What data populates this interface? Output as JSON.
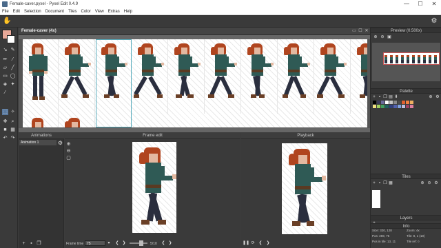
{
  "window": {
    "title": "Female-caver.pyxel - Pyxel Edit 0.4.9",
    "minimize": "—",
    "maximize": "☐",
    "close": "✕"
  },
  "menu": [
    "File",
    "Edit",
    "Selection",
    "Document",
    "Tiles",
    "Color",
    "View",
    "Extras",
    "Help"
  ],
  "document": {
    "title": "Female-caver  (4x)"
  },
  "panels": {
    "animations": "Animations",
    "frame_edit": "Frame edit",
    "playback": "Playback",
    "preview": "Preview (0.500x)",
    "palette": "Palette",
    "tiles": "Tiles",
    "layers": "Layers",
    "info": "Info"
  },
  "animations": {
    "items": [
      "Animation 1"
    ]
  },
  "frame_edit": {
    "frame_time_label": "Frame time",
    "frame_time_value": "75",
    "frame_counter": "5/10"
  },
  "info": {
    "size": "Size: 320, 128",
    "pos": "Pos: 269, 75",
    "pos_in_tile": "Pos in tile: 13, 11",
    "zoom": "Zoom: 4x",
    "tile": "Tile: 8, 1 (18)",
    "tile_ref": "Tile ref: ¤"
  },
  "colors": {
    "primary": "#e8a898",
    "secondary": "#ffffff",
    "palette": [
      "#000000",
      "#3a3a5a",
      "#6a6a9a",
      "#ffffff",
      "#c8c8c8",
      "#8a8a8a",
      "#4a4a4a",
      "#e06030",
      "#f08040",
      "#f0b060",
      "#f0e080",
      "#a0d060",
      "#40a060",
      "#206060",
      "#304080",
      "#5060b0",
      "#80a0e0",
      "#c0c0e0",
      "#a04060",
      "#e080a0"
    ]
  }
}
